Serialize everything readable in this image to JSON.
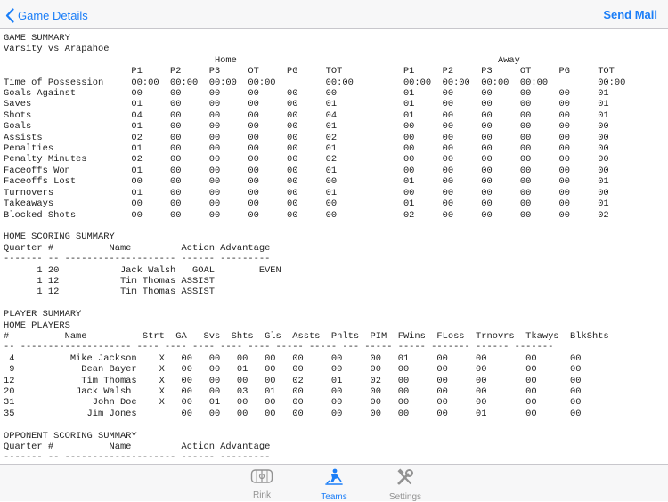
{
  "nav": {
    "back_label": "Game Details",
    "send_label": "Send Mail"
  },
  "report_lines": [
    "GAME SUMMARY",
    "Varsity vs Arapahoe",
    "                                      Home                                               Away",
    "                       P1     P2     P3     OT     PG     TOT           P1     P2     P3     OT     PG     TOT",
    "Time of Possession     00:00  00:00  00:00  00:00         00:00         00:00  00:00  00:00  00:00         00:00",
    "Goals Against          00     00     00     00     00     00            01     00     00     00     00     01",
    "Saves                  01     00     00     00     00     01            01     00     00     00     00     01",
    "Shots                  04     00     00     00     00     04            01     00     00     00     00     01",
    "Goals                  01     00     00     00     00     01            00     00     00     00     00     00",
    "Assists                02     00     00     00     00     02            00     00     00     00     00     00",
    "Penalties              01     00     00     00     00     01            00     00     00     00     00     00",
    "Penalty Minutes        02     00     00     00     00     02            00     00     00     00     00     00",
    "Faceoffs Won           01     00     00     00     00     01            00     00     00     00     00     00",
    "Faceoffs Lost          00     00     00     00     00     00            01     00     00     00     00     01",
    "Turnovers              01     00     00     00     00     01            00     00     00     00     00     00",
    "Takeaways              00     00     00     00     00     00            01     00     00     00     00     01",
    "Blocked Shots          00     00     00     00     00     00            02     00     00     00     00     02",
    "",
    "HOME SCORING SUMMARY",
    "Quarter #          Name         Action Advantage",
    "------- -- -------------------- ------ ---------",
    "      1 20           Jack Walsh   GOAL        EVEN",
    "      1 12           Tim Thomas ASSIST",
    "      1 12           Tim Thomas ASSIST",
    "",
    "PLAYER SUMMARY",
    "HOME PLAYERS",
    "#          Name          Strt  GA   Svs  Shts  Gls  Assts  Pnlts  PIM  FWins  FLoss  Trnovrs  Tkawys  BlkShts",
    "-- -------------------- ---- ---- ---- ---- ---- ----- ----- --- ----- ----- ------- ------ -------",
    " 4          Mike Jackson    X   00   00   00   00   00     00     00   01     00     00       00      00",
    " 9            Dean Bayer    X   00   00   01   00   00     00     00   00     00     00       00      00",
    "12            Tim Thomas    X   00   00   00   00   02     01     02   00     00     00       00      00",
    "20           Jack Walsh     X   00   00   03   01   00     00     00   00     00     00       00      00",
    "31              John Doe    X   00   01   00   00   00     00     00   00     00     00       00      00",
    "35             Jim Jones        00   00   00   00   00     00     00   00     00     01       00      00",
    "",
    "OPPONENT SCORING SUMMARY",
    "Quarter #          Name         Action Advantage",
    "------- -- -------------------- ------ ---------"
  ],
  "tabs": [
    {
      "label": "Rink",
      "icon": "rink-icon",
      "active": false
    },
    {
      "label": "Teams",
      "icon": "hockey-player-icon",
      "active": true
    },
    {
      "label": "Settings",
      "icon": "tools-icon",
      "active": false
    }
  ],
  "colors": {
    "accent": "#1b7ef7",
    "inactive": "#929292",
    "bar": "#f7f7f8"
  }
}
